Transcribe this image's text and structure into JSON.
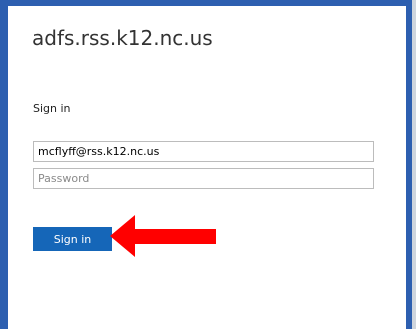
{
  "header": {
    "site_title": "adfs.rss.k12.nc.us"
  },
  "form": {
    "heading": "Sign in",
    "username_value": "mcflyff@rss.k12.nc.us",
    "password_placeholder": "Password",
    "submit_label": "Sign in"
  },
  "annotation": {
    "arrow_icon": "left-arrow-icon",
    "arrow_color": "#ff0000"
  },
  "colors": {
    "page_border": "#2d5fb0",
    "button_background": "#1566b8",
    "button_text": "#ffffff"
  }
}
